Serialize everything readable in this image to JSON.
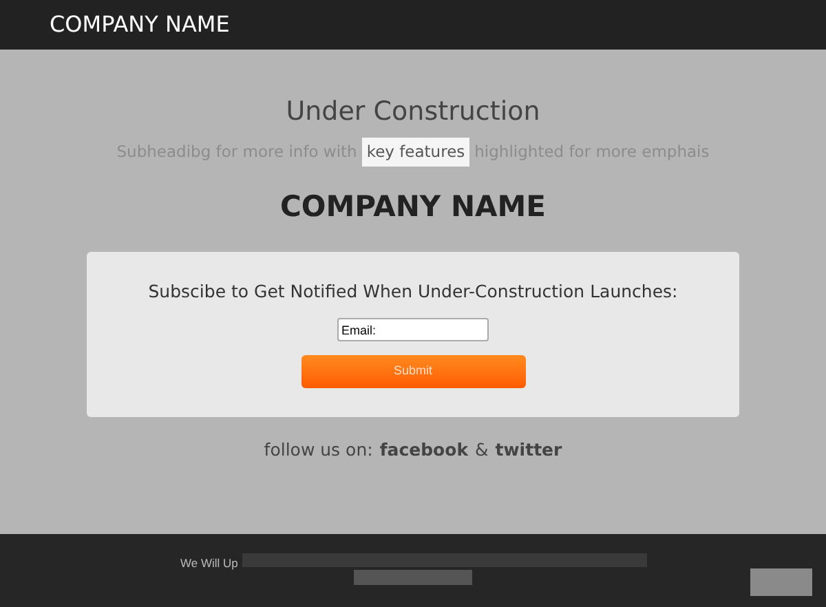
{
  "header": {
    "brand": "COMPANY NAME"
  },
  "hero": {
    "title": "Under Construction",
    "subheading": {
      "before": "Subheadibg for more info with",
      "highlight": "key features",
      "after": "highlighted for more emphais"
    },
    "company": "COMPANY NAME"
  },
  "signup": {
    "heading": "Subscibe to Get Notified When Under-Construction Launches:",
    "email": {
      "value": "Email:"
    },
    "button": "Submit"
  },
  "social": {
    "label": "follow us on:",
    "links": [
      "facebook",
      "twitter"
    ],
    "separator": "&"
  },
  "footer": {
    "text": "We Will Up"
  }
}
